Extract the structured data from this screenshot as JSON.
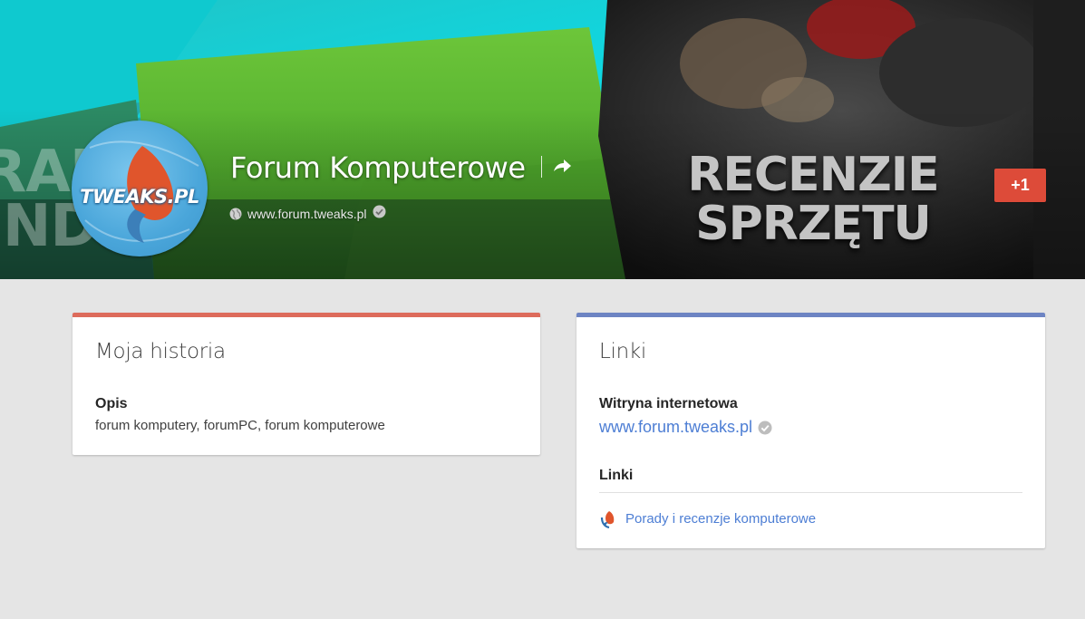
{
  "cover": {
    "left_text": "RAD\nINDO",
    "right_text": "RECENZIE\nSPRZĘTU"
  },
  "profile": {
    "name": "Forum Komputerowe",
    "avatar_text": "TWEAKS.PL",
    "website": "www.forum.tweaks.pl",
    "plus_one_label": "+1"
  },
  "story": {
    "title": "Moja historia",
    "description_label": "Opis",
    "description": "forum komputery, forumPC, forum komputerowe"
  },
  "links": {
    "title": "Linki",
    "website_label": "Witryna internetowa",
    "website_url": "www.forum.tweaks.pl",
    "links_label": "Linki",
    "items": [
      {
        "label": "Porady i recenzje komputerowe",
        "icon": "tweaks-logo-icon"
      }
    ]
  },
  "colors": {
    "story_accent": "#dd6b5b",
    "links_accent": "#6d84c3",
    "plus_one": "#dd4b39",
    "link": "#4d7ed4",
    "background": "#e5e5e5"
  },
  "icons": [
    "globe-icon",
    "verified-check-icon",
    "share-icon",
    "tweaks-logo-icon"
  ]
}
